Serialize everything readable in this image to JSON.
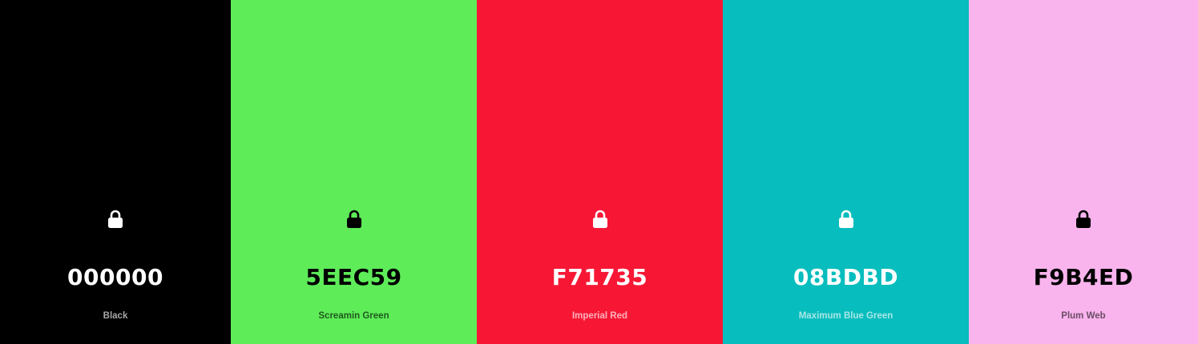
{
  "swatches": [
    {
      "hex": "000000",
      "name": "Black",
      "background": "#000000",
      "text_color": "#FFFFFF",
      "name_color": "#A6A6A6",
      "icon": "lock-icon",
      "icon_color": "#FFFFFF"
    },
    {
      "hex": "5EEC59",
      "name": "Screamin Green",
      "background": "#5EEC59",
      "text_color": "#000000",
      "name_color": "#1F5A1D",
      "icon": "lock-icon",
      "icon_color": "#000000"
    },
    {
      "hex": "F71735",
      "name": "Imperial Red",
      "background": "#F71735",
      "text_color": "#FFFFFF",
      "name_color": "#FBB3BC",
      "icon": "lock-icon",
      "icon_color": "#FFFFFF"
    },
    {
      "hex": "08BDBD",
      "name": "Maximum Blue Green",
      "background": "#08BDBD",
      "text_color": "#FFFFFF",
      "name_color": "#A9E6E6",
      "icon": "lock-icon",
      "icon_color": "#FFFFFF"
    },
    {
      "hex": "F9B4ED",
      "name": "Plum Web",
      "background": "#F9B4ED",
      "text_color": "#000000",
      "name_color": "#6B4D66",
      "icon": "lock-icon",
      "icon_color": "#000000"
    }
  ]
}
